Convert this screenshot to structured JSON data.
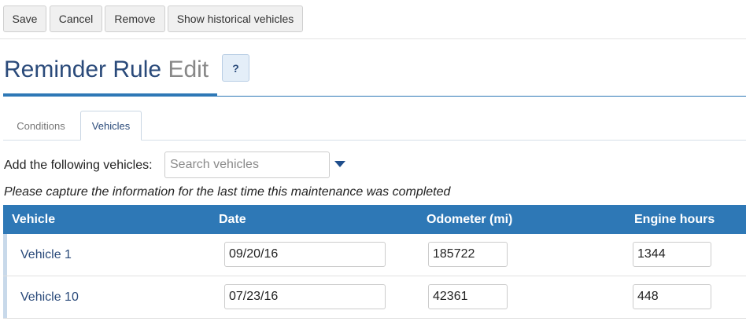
{
  "toolbar": {
    "save_label": "Save",
    "cancel_label": "Cancel",
    "remove_label": "Remove",
    "history_label": "Show historical vehicles"
  },
  "header": {
    "title": "Reminder Rule",
    "subtitle": "Edit",
    "help_label": "?"
  },
  "tabs": [
    {
      "label": "Conditions",
      "active": false
    },
    {
      "label": "Vehicles",
      "active": true
    }
  ],
  "add_vehicles": {
    "label": "Add the following vehicles:",
    "placeholder": "Search vehicles"
  },
  "note": "Please capture the information for the last time this maintenance was completed",
  "table": {
    "columns": [
      "Vehicle",
      "Date",
      "Odometer (mi)",
      "Engine hours"
    ],
    "rows": [
      {
        "vehicle": "Vehicle 1",
        "date": "09/20/16",
        "odometer": "185722",
        "engine_hours": "1344"
      },
      {
        "vehicle": "Vehicle 10",
        "date": "07/23/16",
        "odometer": "42361",
        "engine_hours": "448"
      }
    ]
  },
  "colors": {
    "accent": "#2e78b6",
    "title": "#2a4a7a",
    "subtitle": "#888888"
  }
}
